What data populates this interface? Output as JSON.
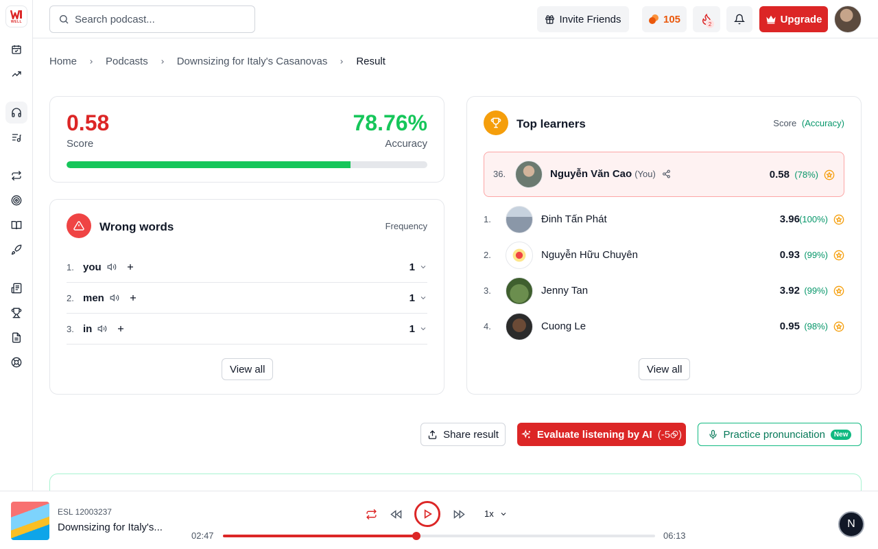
{
  "app": {
    "logo_text": "WELL",
    "brand_color": "#dc2626"
  },
  "sidebar": {
    "items": [
      {
        "icon": "calendar-check-icon"
      },
      {
        "icon": "trending-up-icon"
      },
      {
        "icon": "headphones-icon",
        "active": true
      },
      {
        "icon": "music-list-icon"
      },
      {
        "icon": "repeat-icon"
      },
      {
        "icon": "target-icon"
      },
      {
        "icon": "book-icon"
      },
      {
        "icon": "rocket-icon"
      },
      {
        "icon": "news-icon"
      },
      {
        "icon": "trophy-icon"
      },
      {
        "icon": "document-icon"
      },
      {
        "icon": "help-circle-icon"
      }
    ]
  },
  "header": {
    "search_placeholder": "Search podcast...",
    "invite_label": "Invite Friends",
    "points": "105",
    "streak_count": "2",
    "upgrade_label": "Upgrade"
  },
  "breadcrumb": {
    "items": [
      "Home",
      "Podcasts",
      "Downsizing for Italy's Casanovas",
      "Result"
    ]
  },
  "result": {
    "score": "0.58",
    "score_label": "Score",
    "accuracy": "78.76%",
    "accuracy_label": "Accuracy",
    "accuracy_fraction": 0.7876
  },
  "wrong_words": {
    "title": "Wrong words",
    "column_label": "Frequency",
    "items": [
      {
        "rank": "1.",
        "word": "you",
        "count": "1"
      },
      {
        "rank": "2.",
        "word": "men",
        "count": "1"
      },
      {
        "rank": "3.",
        "word": "in",
        "count": "1"
      }
    ],
    "view_all": "View all"
  },
  "top_learners": {
    "title": "Top learners",
    "header_score": "Score",
    "header_accuracy": "(Accuracy)",
    "me": {
      "rank": "36.",
      "name": "Nguyễn Văn Cao",
      "you_tag": "(You)",
      "score": "0.58",
      "accuracy": "(78%)"
    },
    "items": [
      {
        "rank": "1.",
        "name": "Đinh Tấn Phát",
        "score": "3.96",
        "accuracy": "(100%)"
      },
      {
        "rank": "2.",
        "name": "Nguyễn Hữu Chuyên",
        "score": "0.93",
        "accuracy": "(99%)"
      },
      {
        "rank": "3.",
        "name": "Jenny Tan",
        "score": "3.92",
        "accuracy": "(99%)"
      },
      {
        "rank": "4.",
        "name": "Cuong Le",
        "score": "0.95",
        "accuracy": "(98%)"
      }
    ],
    "view_all": "View all"
  },
  "actions": {
    "share": "Share result",
    "evaluate": "Evaluate listening by AI",
    "evaluate_cost": "(-5",
    "evaluate_cost_close": ")",
    "practice": "Practice pronunciation",
    "new_badge": "New"
  },
  "player": {
    "episode_id": "ESL 12003237",
    "episode_title": "Downsizing for Italy's...",
    "speed": "1x",
    "current_time": "02:47",
    "total_time": "06:13",
    "progress_fraction": 0.4477
  },
  "assistant_button": "N"
}
